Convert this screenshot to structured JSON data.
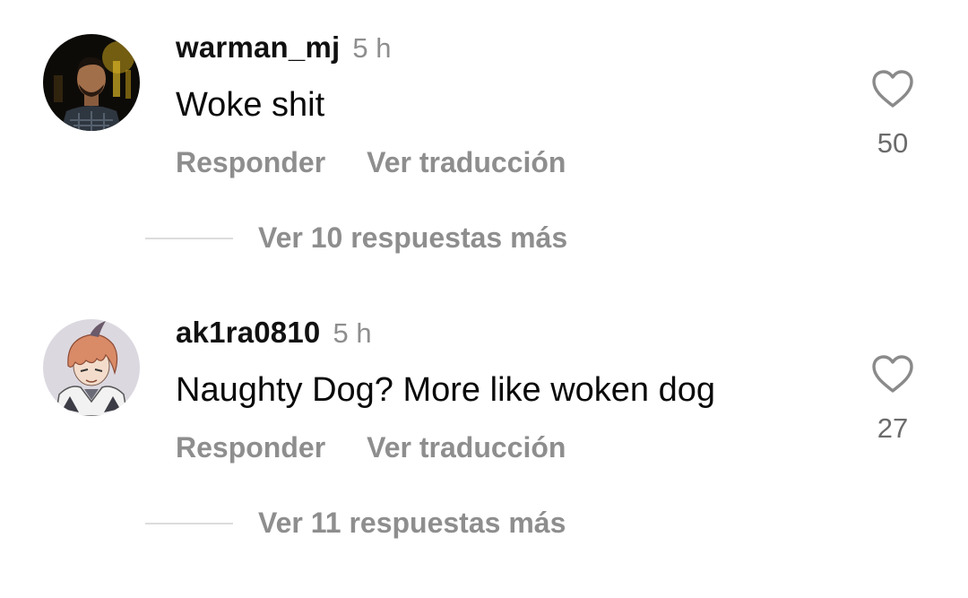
{
  "comments": [
    {
      "username": "warman_mj",
      "time": "5 h",
      "text": "Woke shit",
      "reply_label": "Responder",
      "translate_label": "Ver traducción",
      "likes": "50",
      "more_replies": "Ver 10 respuestas más",
      "avatar": "man-with-beard-photo"
    },
    {
      "username": "ak1ra0810",
      "time": "5 h",
      "text": "Naughty Dog? More like woken dog",
      "reply_label": "Responder",
      "translate_label": "Ver traducción",
      "likes": "27",
      "more_replies": "Ver 11 respuestas más",
      "avatar": "anime-character-drawing"
    }
  ],
  "icons": {
    "like": "heart-outline-icon"
  },
  "colors": {
    "text_primary": "#0a0a0a",
    "text_secondary": "#8e8e8e",
    "divider": "#dcdcdc"
  }
}
